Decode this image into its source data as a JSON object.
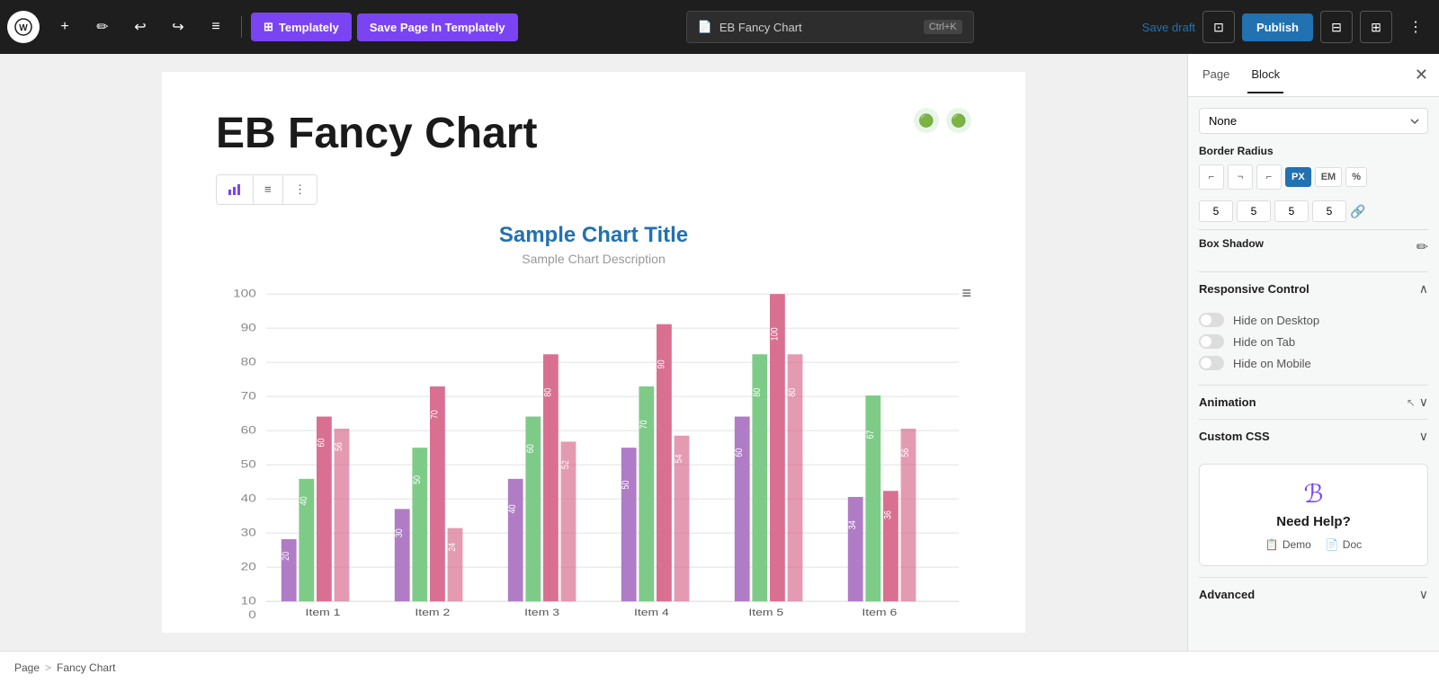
{
  "toolbar": {
    "templately_label": "Templately",
    "save_templately_label": "Save Page In Templately",
    "search_placeholder": "EB Fancy Chart",
    "search_shortcut": "Ctrl+K",
    "save_draft_label": "Save draft",
    "publish_label": "Publish"
  },
  "editor": {
    "page_title": "EB Fancy Chart",
    "chart_title": "Sample Chart Title",
    "chart_description": "Sample Chart Description"
  },
  "right_panel": {
    "tabs": [
      {
        "label": "Page",
        "active": false
      },
      {
        "label": "Block",
        "active": true
      }
    ],
    "dropdown_value": "None",
    "border_radius_label": "Border Radius",
    "border_radius_units": [
      "PX",
      "EM",
      "%"
    ],
    "border_radius_active_unit": "PX",
    "border_radius_values": [
      "5",
      "5",
      "5",
      "5"
    ],
    "box_shadow_label": "Box Shadow",
    "responsive_control_label": "Responsive Control",
    "hide_desktop_label": "Hide on Desktop",
    "hide_tab_label": "Hide on Tab",
    "hide_mobile_label": "Hide on Mobile",
    "animation_label": "Animation",
    "custom_css_label": "Custom CSS",
    "advanced_label": "Advanced",
    "help_title": "Need Help?",
    "demo_label": "Demo",
    "doc_label": "Doc"
  },
  "breadcrumb": {
    "home": "Page",
    "separator": ">",
    "current": "Fancy Chart"
  },
  "chart": {
    "groups": [
      {
        "label": "Item 1",
        "bars": [
          {
            "value": 20,
            "color": "#b07cc6"
          },
          {
            "value": 40,
            "color": "#7ecb88"
          },
          {
            "value": 60,
            "color": "#d97092"
          },
          {
            "value": 56,
            "color": "#d97092"
          }
        ]
      },
      {
        "label": "Item 2",
        "bars": [
          {
            "value": 30,
            "color": "#b07cc6"
          },
          {
            "value": 50,
            "color": "#7ecb88"
          },
          {
            "value": 70,
            "color": "#d97092"
          },
          {
            "value": 24,
            "color": "#d97092"
          }
        ]
      },
      {
        "label": "Item 3",
        "bars": [
          {
            "value": 40,
            "color": "#b07cc6"
          },
          {
            "value": 60,
            "color": "#7ecb88"
          },
          {
            "value": 80,
            "color": "#d97092"
          },
          {
            "value": 52,
            "color": "#d97092"
          }
        ]
      },
      {
        "label": "Item 4",
        "bars": [
          {
            "value": 50,
            "color": "#b07cc6"
          },
          {
            "value": 70,
            "color": "#7ecb88"
          },
          {
            "value": 90,
            "color": "#d97092"
          },
          {
            "value": 54,
            "color": "#d97092"
          }
        ]
      },
      {
        "label": "Item 5",
        "bars": [
          {
            "value": 60,
            "color": "#b07cc6"
          },
          {
            "value": 80,
            "color": "#7ecb88"
          },
          {
            "value": 100,
            "color": "#d97092"
          },
          {
            "value": 80,
            "color": "#d97092"
          }
        ]
      },
      {
        "label": "Item 6",
        "bars": [
          {
            "value": 34,
            "color": "#b07cc6"
          },
          {
            "value": 67,
            "color": "#7ecb88"
          },
          {
            "value": 36,
            "color": "#d97092"
          },
          {
            "value": 56,
            "color": "#d97092"
          }
        ]
      }
    ]
  }
}
